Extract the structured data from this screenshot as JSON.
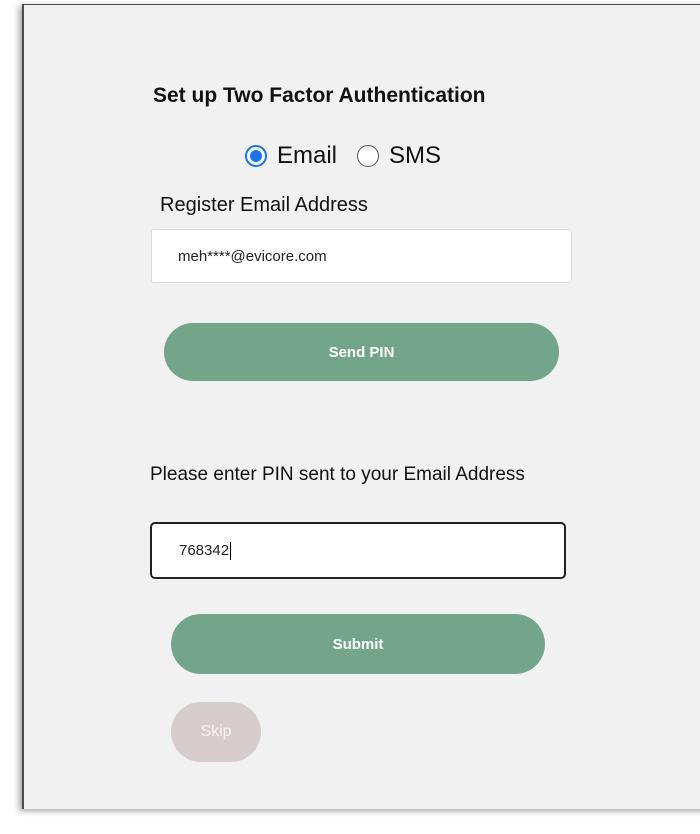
{
  "title": "Set up Two Factor Authentication",
  "method": {
    "options": [
      {
        "label": "Email",
        "selected": true
      },
      {
        "label": "SMS",
        "selected": false
      }
    ]
  },
  "email": {
    "label": "Register Email Address",
    "value": "meh****@evicore.com"
  },
  "send_pin": {
    "label": "Send PIN"
  },
  "pin": {
    "label": "Please enter PIN sent to your Email Address",
    "value": "768342"
  },
  "submit": {
    "label": "Submit"
  },
  "skip": {
    "label": "Skip"
  },
  "colors": {
    "primary_button": "#72a58a",
    "disabled_button": "#d6cccc",
    "radio_accent": "#1a73e8",
    "background": "#f1f1f1"
  }
}
